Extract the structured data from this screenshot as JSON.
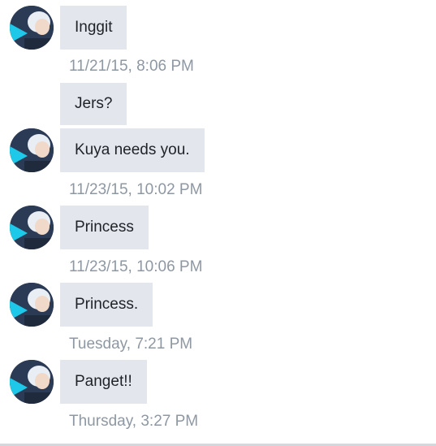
{
  "messages": [
    {
      "text": "Inggit",
      "timestamp": "11/21/15, 8:06 PM"
    },
    {
      "text": "Jers?"
    },
    {
      "text": "Kuya needs you.",
      "timestamp": "11/23/15, 10:02 PM"
    },
    {
      "text": "Princess",
      "timestamp": "11/23/15, 10:06 PM"
    },
    {
      "text": "Princess.",
      "timestamp": "Tuesday, 7:21 PM"
    },
    {
      "text": "Panget!!",
      "timestamp": "Thursday, 3:27 PM"
    }
  ],
  "avatar": {
    "icon": "contact-avatar-icon"
  },
  "colors": {
    "bubble_bg": "#e3e7ed",
    "message_text": "#1f2328",
    "timestamp_text": "#8e98a3",
    "background": "#ffffff"
  }
}
